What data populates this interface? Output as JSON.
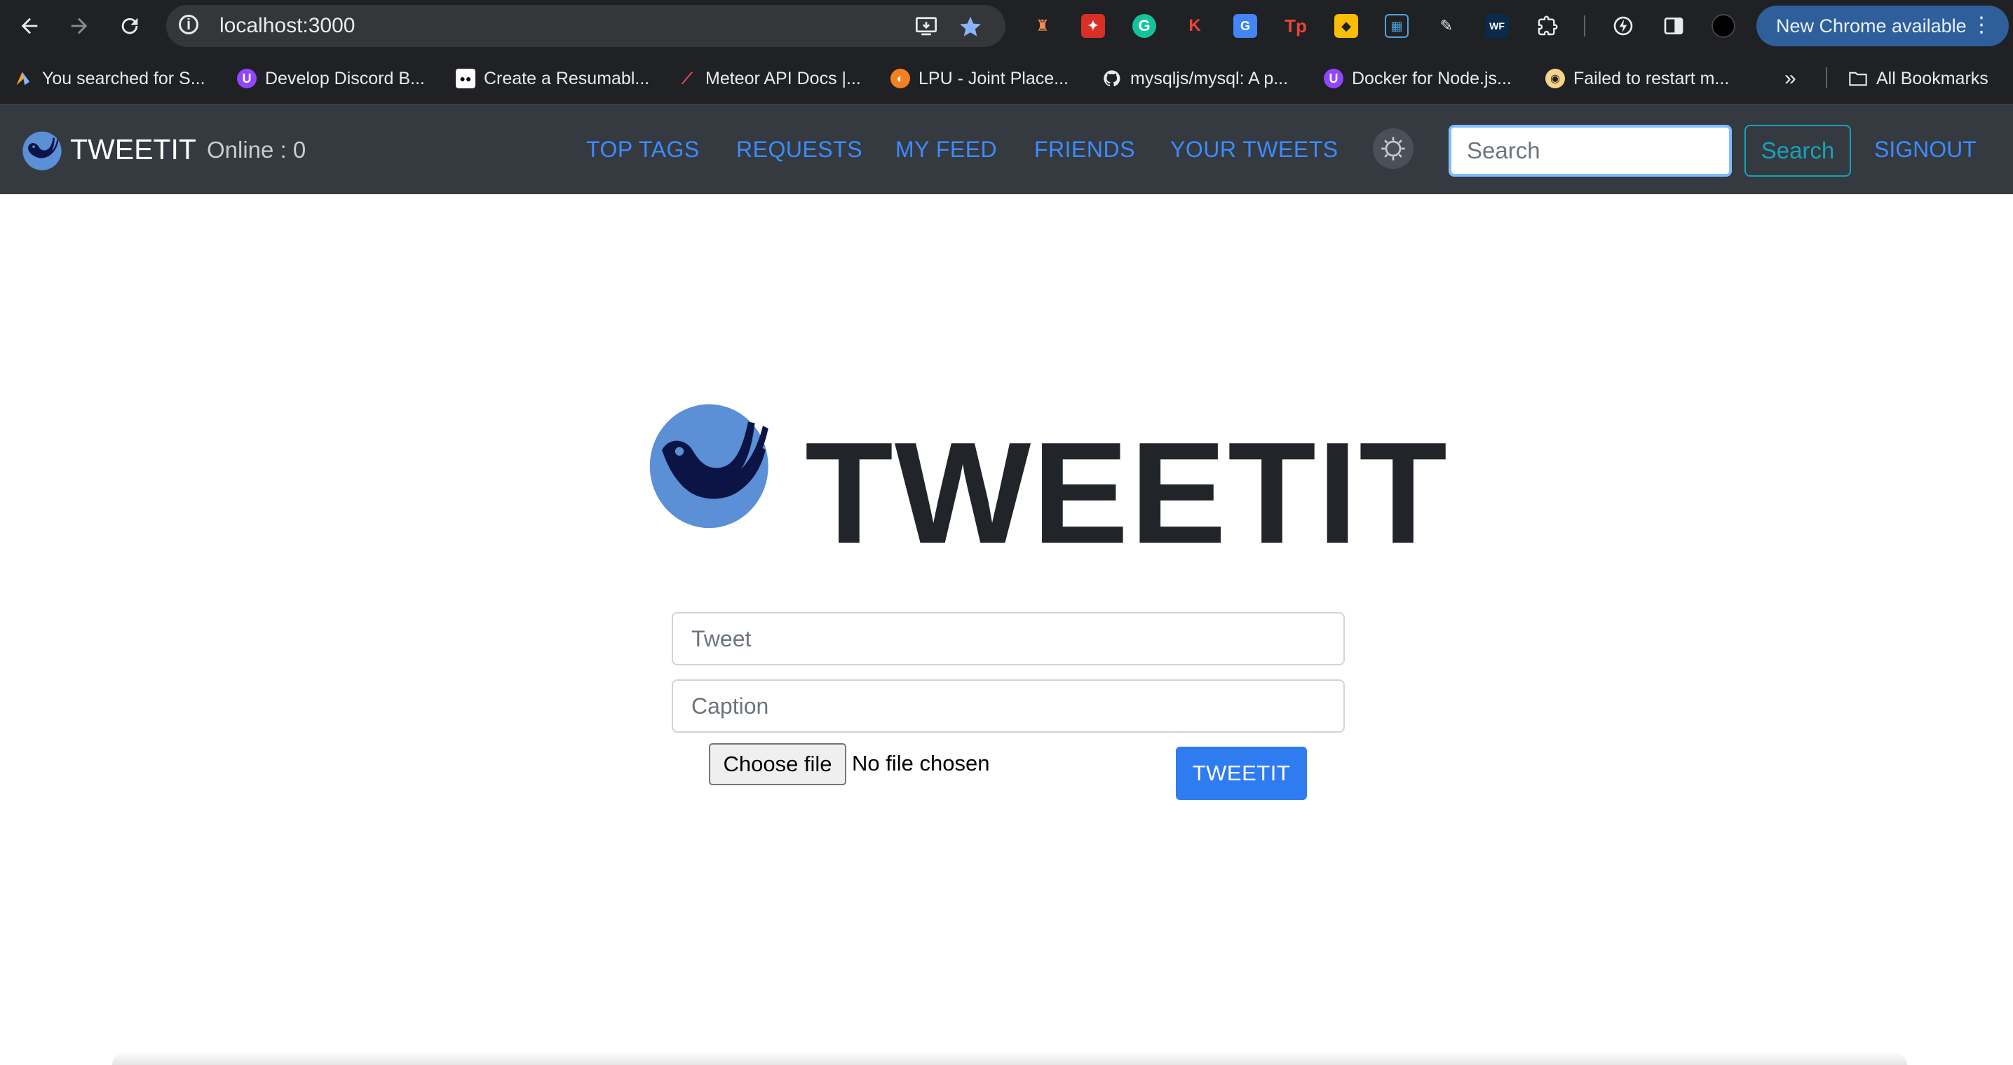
{
  "browser": {
    "url": "localhost:3000",
    "update_label": "New Chrome available",
    "bookmarks": [
      {
        "label": "You searched for S...",
        "icon": "bookmark-favicon-icon"
      },
      {
        "label": "Develop Discord B...",
        "icon": "purple-favicon-icon"
      },
      {
        "label": "Create a Resumabl...",
        "icon": "medium-icon"
      },
      {
        "label": "Meteor API Docs |...",
        "icon": "meteor-icon"
      },
      {
        "label": "LPU - Joint Place...",
        "icon": "lpu-icon"
      },
      {
        "label": "mysqljs/mysql: A p...",
        "icon": "github-icon"
      },
      {
        "label": "Docker for Node.js...",
        "icon": "purple-favicon-icon"
      },
      {
        "label": "Failed to restart m...",
        "icon": "ghost-icon"
      }
    ],
    "all_bookmarks_label": "All Bookmarks"
  },
  "navbar": {
    "brand": "TWEETIT",
    "online": "Online : 0",
    "links": [
      "TOP TAGS",
      "REQUESTS",
      "MY FEED",
      "FRIENDS",
      "YOUR TWEETS"
    ],
    "search_placeholder": "Search",
    "search_button": "Search",
    "signout": "SIGNOUT"
  },
  "main": {
    "title": "TWEETIT",
    "tweet_placeholder": "Tweet",
    "caption_placeholder": "Caption",
    "choose_file_label": "Choose file",
    "file_status": "No file chosen",
    "submit_label": "TWEETIT"
  },
  "colors": {
    "navbar_bg": "#343a40",
    "link": "#3d8bfd",
    "primary_button": "#2f7bf0",
    "logo_circle": "#5b8fd6",
    "logo_bird": "#0c1446"
  }
}
